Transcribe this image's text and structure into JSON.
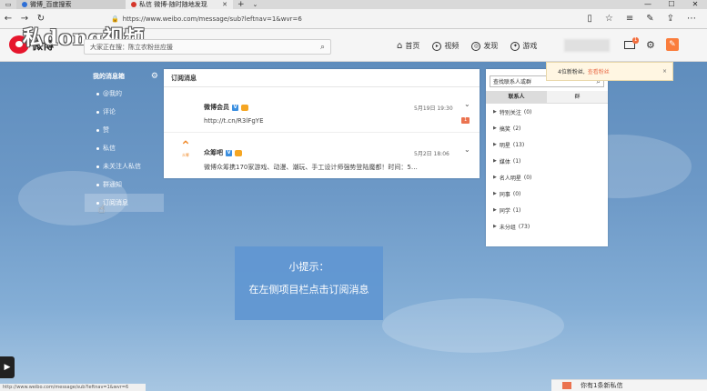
{
  "browser": {
    "tabs": [
      {
        "label": "微博_百度搜索",
        "active": false
      },
      {
        "label": "私信 微博-随时随地发现",
        "active": true
      }
    ],
    "tab_close": "✕",
    "new_tab": "+",
    "tab_dropdown": "⌄",
    "window_controls": [
      "—",
      "☐",
      "✕"
    ],
    "url_prefix": "https://",
    "url": "www.weibo.com/message/sub?leftnav=1&wvr=6"
  },
  "watermark": "私dong视频",
  "weibo": {
    "logo_text": "微博",
    "search_placeholder": "大家正在搜：陈立农粉丝应援",
    "nav": [
      {
        "label": "首页",
        "icon": "home-icon"
      },
      {
        "label": "视频",
        "icon": "video-icon"
      },
      {
        "label": "发现",
        "icon": "discover-icon"
      },
      {
        "label": "游戏",
        "icon": "game-icon"
      }
    ],
    "mail_badge": "1"
  },
  "sidebar": {
    "title": "我的消息箱",
    "items": [
      {
        "label": "@我的"
      },
      {
        "label": "评论"
      },
      {
        "label": "赞"
      },
      {
        "label": "私信"
      },
      {
        "label": "未关注人私信"
      },
      {
        "label": "群通知"
      },
      {
        "label": "订阅消息",
        "active": true
      }
    ]
  },
  "panel": {
    "title": "订阅消息",
    "messages": [
      {
        "name": "微博会员",
        "time": "5月19日 19:30",
        "body": "http://t.cn/R3lFgYE",
        "count": "1"
      },
      {
        "name": "众筹吧",
        "time": "5月2日 18:06",
        "body": "微博众筹携170家游戏、动漫、潮玩、手工设计师强势登陆魔都！时间：5…",
        "logo_label": "众筹"
      }
    ]
  },
  "contacts": {
    "search_placeholder": "查找联系人或群",
    "tabs": [
      "联系人",
      "群"
    ],
    "groups": [
      {
        "label": "特别关注",
        "count": "(0)"
      },
      {
        "label": "搞笑",
        "count": "(2)"
      },
      {
        "label": "明星",
        "count": "(13)"
      },
      {
        "label": "媒体",
        "count": "(1)"
      },
      {
        "label": "名人明星",
        "count": "(0)"
      },
      {
        "label": "同事",
        "count": "(0)"
      },
      {
        "label": "同学",
        "count": "(1)"
      },
      {
        "label": "未分组",
        "count": "(73)"
      }
    ]
  },
  "notification": {
    "text": "4位新粉丝,",
    "link": "查看粉丝",
    "close": "×"
  },
  "tip": {
    "line1": "小提示：",
    "line2": "在左侧项目栏点击订阅消息"
  },
  "private_msg_bar": "你有1条新私信",
  "status_url": "http://www.weibo.com/message/sub?leftnav=1&wvr=6"
}
